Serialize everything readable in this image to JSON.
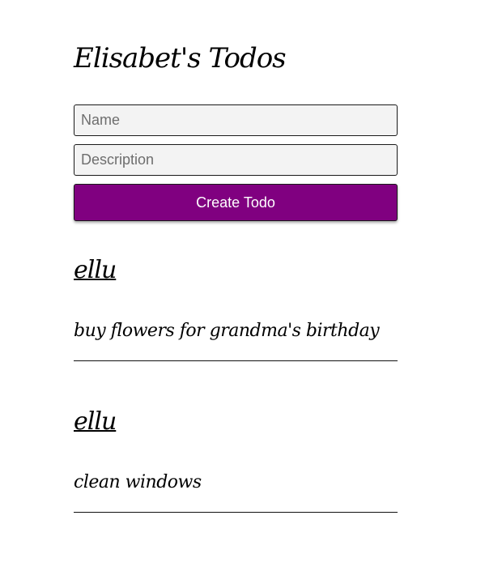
{
  "app": {
    "title": "Elisabet's Todos"
  },
  "form": {
    "name_placeholder": "Name",
    "name_value": "",
    "description_placeholder": "Description",
    "description_value": "",
    "create_label": "Create Todo"
  },
  "todos": [
    {
      "name": "ellu",
      "description": "buy flowers for grandma's birthday"
    },
    {
      "name": "ellu",
      "description": "clean windows"
    }
  ],
  "colors": {
    "button_background": "#800080",
    "button_text": "#ffffff",
    "input_background": "#f3f3f3"
  }
}
